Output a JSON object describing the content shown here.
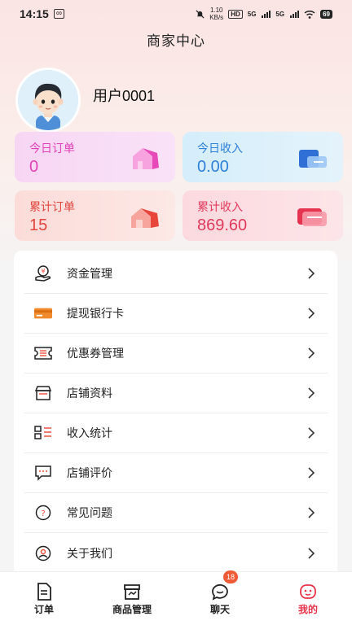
{
  "status_bar": {
    "time": "14:15",
    "sim_label": "∞",
    "speed_value": "1.10",
    "speed_unit": "KB/s",
    "hd_label": "HD",
    "network_1": "5G",
    "network_2": "5G",
    "battery": "69"
  },
  "header": {
    "title": "商家中心"
  },
  "profile": {
    "username": "用户0001"
  },
  "stats": {
    "today_orders": {
      "label": "今日订单",
      "value": "0"
    },
    "today_income": {
      "label": "今日收入",
      "value": "0.00"
    },
    "total_orders": {
      "label": "累计订单",
      "value": "15"
    },
    "total_income": {
      "label": "累计收入",
      "value": "869.60"
    }
  },
  "menu": {
    "items": [
      {
        "label": "资金管理",
        "icon": "money-hand-icon"
      },
      {
        "label": "提现银行卡",
        "icon": "bank-card-icon"
      },
      {
        "label": "优惠券管理",
        "icon": "coupon-icon"
      },
      {
        "label": "店铺资料",
        "icon": "store-icon"
      },
      {
        "label": "收入统计",
        "icon": "stats-list-icon"
      },
      {
        "label": "店铺评价",
        "icon": "comment-icon"
      },
      {
        "label": "常见问题",
        "icon": "question-icon"
      },
      {
        "label": "关于我们",
        "icon": "about-icon"
      }
    ]
  },
  "tabs": [
    {
      "label": "订单",
      "icon": "order-doc-icon"
    },
    {
      "label": "商品管理",
      "icon": "goods-icon"
    },
    {
      "label": "聊天",
      "icon": "chat-icon",
      "badge": "18"
    },
    {
      "label": "我的",
      "icon": "me-face-icon",
      "active": true
    }
  ],
  "colors": {
    "accent": "#e8344a",
    "badge": "#f05a37",
    "orders_text": "#e042b6",
    "income_text": "#2d7fd8",
    "total_orders_text": "#e0463d",
    "total_income_text": "#e23a5c",
    "menu_icon_orange": "#f08a2c"
  }
}
